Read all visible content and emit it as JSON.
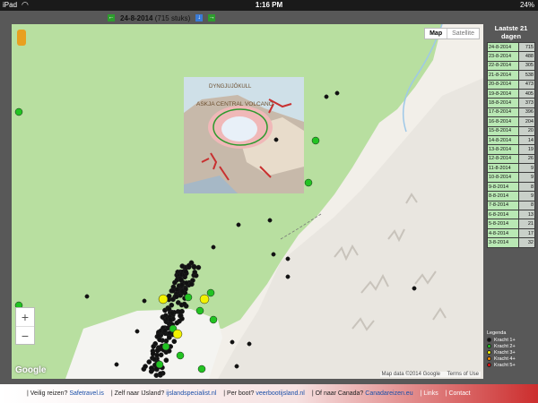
{
  "statusbar": {
    "device": "iPad",
    "time": "1:16 PM",
    "battery": "24%"
  },
  "header": {
    "date_title": "24-8-2014",
    "count_text": "(715 stuks)",
    "prev_label": "←",
    "down_label": "↓",
    "next_label": "→"
  },
  "map": {
    "map_type_active": "Map",
    "map_type_inactive": "Satellite",
    "zoom_in": "+",
    "zoom_out": "−",
    "logo": "Google",
    "attribution_data": "Map data ©2014 Google",
    "attribution_terms": "Terms of Use",
    "inset_label_top": "DYNGJUJÖKULL",
    "inset_label_volcano": "ASKJA CENTRAL VOLCANO"
  },
  "sidebar": {
    "title": "Laatste 21 dagen",
    "days": [
      {
        "date": "24-8-2014",
        "count": "715"
      },
      {
        "date": "23-8-2014",
        "count": "488"
      },
      {
        "date": "22-8-2014",
        "count": "305"
      },
      {
        "date": "21-8-2014",
        "count": "538"
      },
      {
        "date": "20-8-2014",
        "count": "473"
      },
      {
        "date": "19-8-2014",
        "count": "405"
      },
      {
        "date": "18-8-2014",
        "count": "373"
      },
      {
        "date": "17-8-2014",
        "count": "396"
      },
      {
        "date": "16-8-2014",
        "count": "204"
      },
      {
        "date": "15-8-2014",
        "count": "20"
      },
      {
        "date": "14-8-2014",
        "count": "14"
      },
      {
        "date": "13-8-2014",
        "count": "19"
      },
      {
        "date": "12-8-2014",
        "count": "26"
      },
      {
        "date": "11-8-2014",
        "count": "9"
      },
      {
        "date": "10-8-2014",
        "count": "9"
      },
      {
        "date": "9-8-2014",
        "count": "8"
      },
      {
        "date": "8-8-2014",
        "count": "9"
      },
      {
        "date": "7-8-2014",
        "count": "8"
      },
      {
        "date": "6-8-2014",
        "count": "13"
      },
      {
        "date": "5-8-2014",
        "count": "21"
      },
      {
        "date": "4-8-2014",
        "count": "17"
      },
      {
        "date": "3-8-2014",
        "count": "32"
      }
    ]
  },
  "legend": {
    "title": "Legenda",
    "items": [
      {
        "label": "Kracht 1+",
        "color": "#111111"
      },
      {
        "label": "Kracht 2+",
        "color": "#22c322"
      },
      {
        "label": "Kracht 3+",
        "color": "#f2f200"
      },
      {
        "label": "Kracht 4+",
        "color": "#f28a00"
      },
      {
        "label": "Kracht 5+",
        "color": "#e01010"
      }
    ]
  },
  "footer": [
    {
      "prefix": "Veilig reizen?",
      "link": "Safetravel.is"
    },
    {
      "prefix": "Zelf naar IJsland?",
      "link": "ijslandspecialist.nl"
    },
    {
      "prefix": "Per boot?",
      "link": "veerbootijsland.nl"
    },
    {
      "prefix": "Of naar Canada?",
      "link": "Canadareizen.eu"
    },
    {
      "prefix": "",
      "link": "Links"
    },
    {
      "prefix": "",
      "link": "Contact"
    }
  ],
  "colors": {
    "map_green": "#b8dfa0",
    "map_bg": "#f2efe9",
    "list_bg": "#b9e8b4",
    "quake_small": "#111111",
    "quake_medium": "#22c322",
    "quake_large": "#f2f200"
  }
}
